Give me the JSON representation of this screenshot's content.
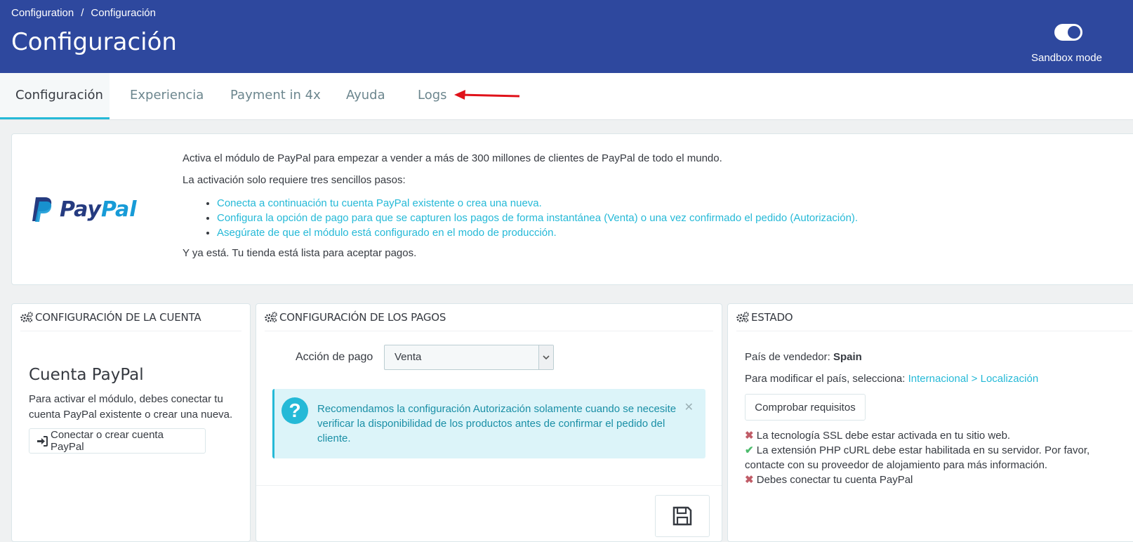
{
  "breadcrumb": {
    "parent": "Configuration",
    "separator": "/",
    "current": "Configuración"
  },
  "page_title": "Configuración",
  "sandbox": {
    "label": "Sandbox mode",
    "enabled": true
  },
  "tabs": [
    {
      "label": "Configuración",
      "active": true
    },
    {
      "label": "Experiencia",
      "active": false
    },
    {
      "label": "Payment in 4x",
      "active": false
    },
    {
      "label": "Ayuda",
      "active": false
    },
    {
      "label": "Logs",
      "active": false
    }
  ],
  "intro": {
    "logo_text_1": "Pay",
    "logo_text_2": "Pal",
    "p1": "Activa el módulo de PayPal para empezar a vender a más de 300 millones de clientes de PayPal de todo el mundo.",
    "p2": "La activación solo requiere tres sencillos pasos:",
    "steps": [
      "Conecta a continuación tu cuenta PayPal existente o crea una nueva.",
      "Configura la opción de pago para que se capturen los pagos de forma instantánea (Venta) o una vez confirmado el pedido (Autorización).",
      "Asegúrate de que el módulo está configurado en el modo de producción."
    ],
    "p3": "Y ya está. Tu tienda está lista para aceptar pagos."
  },
  "account_panel": {
    "header": "CONFIGURACIÓN DE LA CUENTA",
    "title": "Cuenta PayPal",
    "description": "Para activar el módulo, debes conectar tu cuenta PayPal existente o crear una nueva.",
    "connect_button": "Conectar o crear cuenta PayPal"
  },
  "payments_panel": {
    "header": "CONFIGURACIÓN DE LOS PAGOS",
    "action_label": "Acción de pago",
    "action_value": "Venta",
    "alert": "Recomendamos la configuración Autorización solamente cuando se necesite verificar la disponibilidad de los productos antes de confirmar el pedido del cliente."
  },
  "status_panel": {
    "header": "ESTADO",
    "country_label": "País de vendedor:",
    "country_value": "Spain",
    "modify_text": "Para modificar el país, selecciona:",
    "modify_link": "Internacional > Localización",
    "check_button": "Comprobar requisitos",
    "requirements": [
      {
        "status": "fail",
        "text": "La tecnología SSL debe estar activada en tu sitio web."
      },
      {
        "status": "ok",
        "text": "La extensión PHP cURL debe estar habilitada en su servidor. Por favor, contacte con su proveedor de alojamiento para más información."
      },
      {
        "status": "fail",
        "text": "Debes conectar tu cuenta PayPal"
      }
    ]
  },
  "colors": {
    "header_bg": "#2e489e",
    "accent": "#25b9d7",
    "arrow": "#e0121a"
  }
}
